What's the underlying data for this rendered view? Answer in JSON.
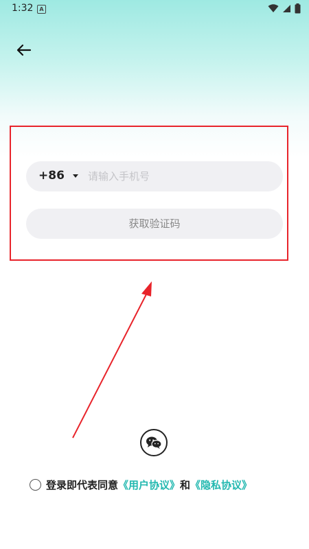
{
  "status_bar": {
    "time": "1:32",
    "notification_icon": "A",
    "icons": [
      "wifi-icon",
      "signal-icon",
      "battery-icon"
    ]
  },
  "header": {
    "back_icon": "back-arrow-icon"
  },
  "form": {
    "country_code": "+86",
    "phone_placeholder": "请输入手机号",
    "phone_value": "",
    "get_code_label": "获取验证码"
  },
  "social_login": {
    "icon": "wechat-icon"
  },
  "agreement": {
    "checked": false,
    "prefix": "登录即代表同意",
    "user_agreement": "《用户协议》",
    "connector": "和",
    "privacy_policy": "《隐私协议》"
  },
  "colors": {
    "accent": "#23b8b0",
    "annotation": "#e8232a",
    "field_bg": "#f0f0f3",
    "header_gradient_top": "#9ee9e2"
  }
}
